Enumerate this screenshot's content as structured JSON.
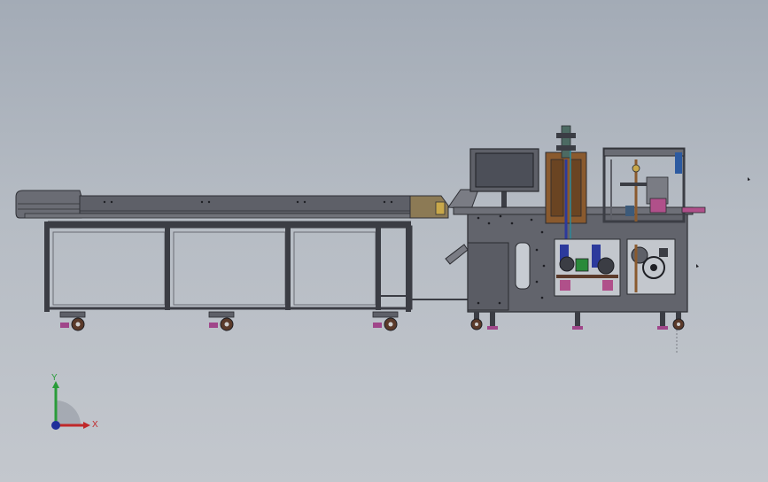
{
  "viewport": {
    "background_top": "#a3abb6",
    "background_bottom": "#c3c7cd"
  },
  "model": {
    "frame_color": "#5e6068",
    "frame_dark": "#3b3d44",
    "panel_color": "#6a6c74",
    "bronze_color": "#8a5a2e",
    "blue_color": "#2c3a9c",
    "pink_color": "#b0508a",
    "caster_color": "#5b3a2a",
    "caster_pad_color": "#a0468a",
    "screen_color": "#4c4f58"
  },
  "triad": {
    "x_label": "X",
    "y_label": "Y",
    "x_color": "#c0282a",
    "y_color": "#2a9c3a",
    "z_color": "#1f2f9a"
  }
}
